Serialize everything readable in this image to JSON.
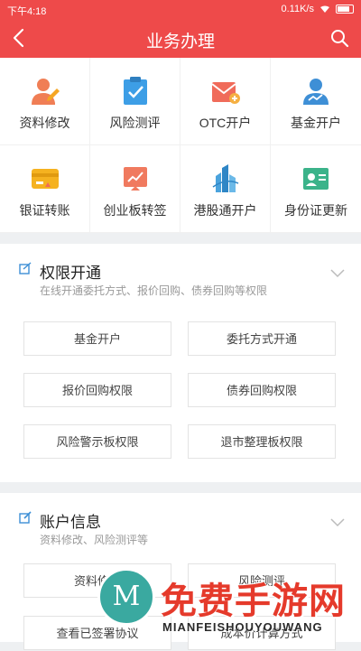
{
  "status_bar": {
    "time": "下午4:18",
    "speed": "0.11K/s"
  },
  "header": {
    "title": "业务办理"
  },
  "services": [
    {
      "label": "资料修改",
      "icon": "user-edit-icon"
    },
    {
      "label": "风险测评",
      "icon": "risk-check-icon"
    },
    {
      "label": "OTC开户",
      "icon": "otc-envelope-icon"
    },
    {
      "label": "基金开户",
      "icon": "fund-user-icon"
    },
    {
      "label": "银证转账",
      "icon": "bank-card-icon"
    },
    {
      "label": "创业板转签",
      "icon": "gem-board-icon"
    },
    {
      "label": "港股通开户",
      "icon": "hk-connect-icon"
    },
    {
      "label": "身份证更新",
      "icon": "id-card-icon"
    }
  ],
  "permissions": {
    "title": "权限开通",
    "subtitle": "在线开通委托方式、报价回购、债券回购等权限",
    "buttons": [
      "基金开户",
      "委托方式开通",
      "报价回购权限",
      "债券回购权限",
      "风险警示板权限",
      "退市整理板权限"
    ]
  },
  "account": {
    "title": "账户信息",
    "subtitle": "资料修改、风险测评等",
    "buttons": [
      "资料修改",
      "风险测评",
      "查看已签署协议",
      "成本价计算方式"
    ]
  },
  "watermark": {
    "title": "免费手游网",
    "domain": "MIANFEISHOUYOUWANG",
    "logo_letter": "M"
  },
  "colors": {
    "brand_red": "#ee4a4a",
    "background": "#eef0f2"
  }
}
